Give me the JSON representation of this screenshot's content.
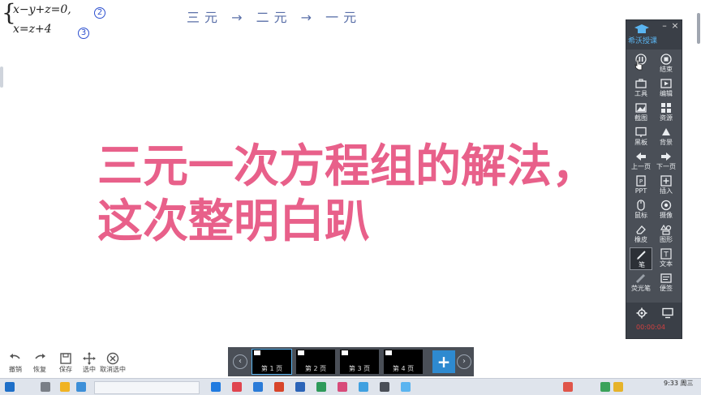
{
  "board": {
    "equations": {
      "eq1": "x−y+z=0,",
      "eq2": "x=z+4",
      "mark1": "2",
      "mark2": "3"
    },
    "handwriting": "三元 → 二元 → 一元",
    "title": "三元一次方程组的解法，这次整明白趴"
  },
  "toolbar": {
    "brand": "希沃授课",
    "minimize": "–",
    "close": "×",
    "buttons": [
      {
        "label": "",
        "icon": "pause-icon"
      },
      {
        "label": "结束",
        "icon": "stop-icon"
      },
      {
        "label": "工具",
        "icon": "toolbox-icon"
      },
      {
        "label": "编辑",
        "icon": "film-edit-icon"
      },
      {
        "label": "截图",
        "icon": "screenshot-icon"
      },
      {
        "label": "资源",
        "icon": "resource-icon"
      },
      {
        "label": "黑板",
        "icon": "blackboard-icon"
      },
      {
        "label": "背景",
        "icon": "background-icon"
      },
      {
        "label": "上一页",
        "icon": "arrow-left-icon"
      },
      {
        "label": "下一页",
        "icon": "arrow-right-icon"
      },
      {
        "label": "PPT",
        "icon": "ppt-icon"
      },
      {
        "label": "插入",
        "icon": "insert-icon"
      },
      {
        "label": "鼠标",
        "icon": "mouse-icon"
      },
      {
        "label": "摄像",
        "icon": "camera-icon"
      },
      {
        "label": "橡皮",
        "icon": "eraser-icon"
      },
      {
        "label": "图形",
        "icon": "shapes-icon"
      },
      {
        "label": "笔",
        "icon": "pen-icon"
      },
      {
        "label": "文本",
        "icon": "text-icon"
      },
      {
        "label": "荧光笔",
        "icon": "highlighter-icon"
      },
      {
        "label": "便签",
        "icon": "note-icon"
      }
    ],
    "timer": "00:00:04",
    "colors": {
      "panel": "#4a4f57",
      "accent": "#5ab4f0",
      "timer": "#d24040"
    }
  },
  "bottom_tools": [
    {
      "label": "撤销",
      "icon": "undo-icon"
    },
    {
      "label": "恢复",
      "icon": "redo-icon"
    },
    {
      "label": "保存",
      "icon": "save-icon"
    },
    {
      "label": "选中",
      "icon": "move-icon"
    },
    {
      "label": "取消选中",
      "icon": "cancel-select-icon"
    }
  ],
  "pages": {
    "items": [
      {
        "label": "第 1 页"
      },
      {
        "label": "第 2 页"
      },
      {
        "label": "第 3 页"
      },
      {
        "label": "第 4 页"
      }
    ],
    "prev": "‹",
    "next": "›",
    "add": "+"
  },
  "taskbar": {
    "time": "9:33 周三"
  }
}
